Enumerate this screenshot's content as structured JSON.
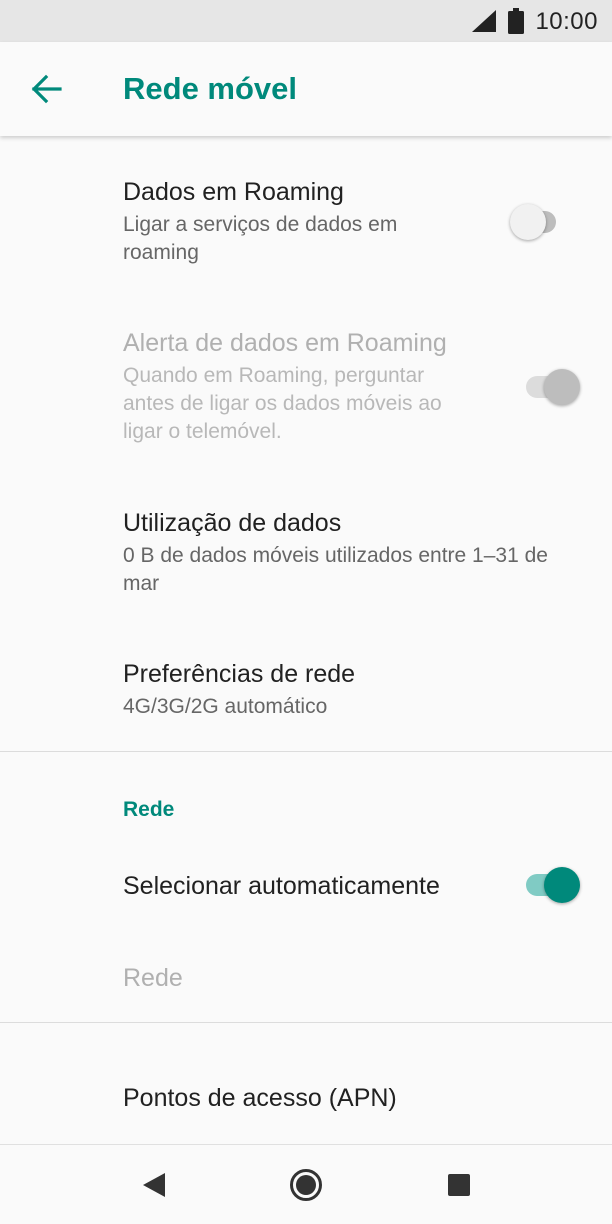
{
  "status_bar": {
    "time": "10:00",
    "icons": [
      "signal-icon",
      "battery-icon"
    ]
  },
  "header": {
    "back_icon": "arrow-back-icon",
    "title": "Rede móvel"
  },
  "preferences": [
    {
      "title": "Dados em Roaming",
      "summary": "Ligar a serviços de dados em roaming",
      "switch_on": false,
      "enabled": true
    },
    {
      "title": "Alerta de dados em Roaming",
      "summary": "Quando em Roaming, perguntar antes de ligar os dados móveis ao ligar o telemóvel.",
      "switch_on": true,
      "enabled": false
    },
    {
      "title": "Utilização de dados",
      "summary": "0 B de dados móveis utilizados entre 1–31 de mar"
    },
    {
      "title": "Preferências de rede",
      "summary": "4G/3G/2G automático"
    }
  ],
  "network_section": {
    "header": "Rede",
    "auto_select": {
      "title": "Selecionar automaticamente",
      "switch_on": true
    },
    "network": {
      "title": "Rede",
      "enabled": false
    }
  },
  "apn": {
    "title": "Pontos de acesso (APN)"
  },
  "nav_bar": {
    "icons": [
      "back-triangle-icon",
      "home-circle-icon",
      "recents-square-icon"
    ]
  },
  "colors": {
    "accent": "#00897b",
    "accent_track": "#80cbc4",
    "status_bar_bg": "#e6e6e6",
    "background": "#fafafa"
  }
}
